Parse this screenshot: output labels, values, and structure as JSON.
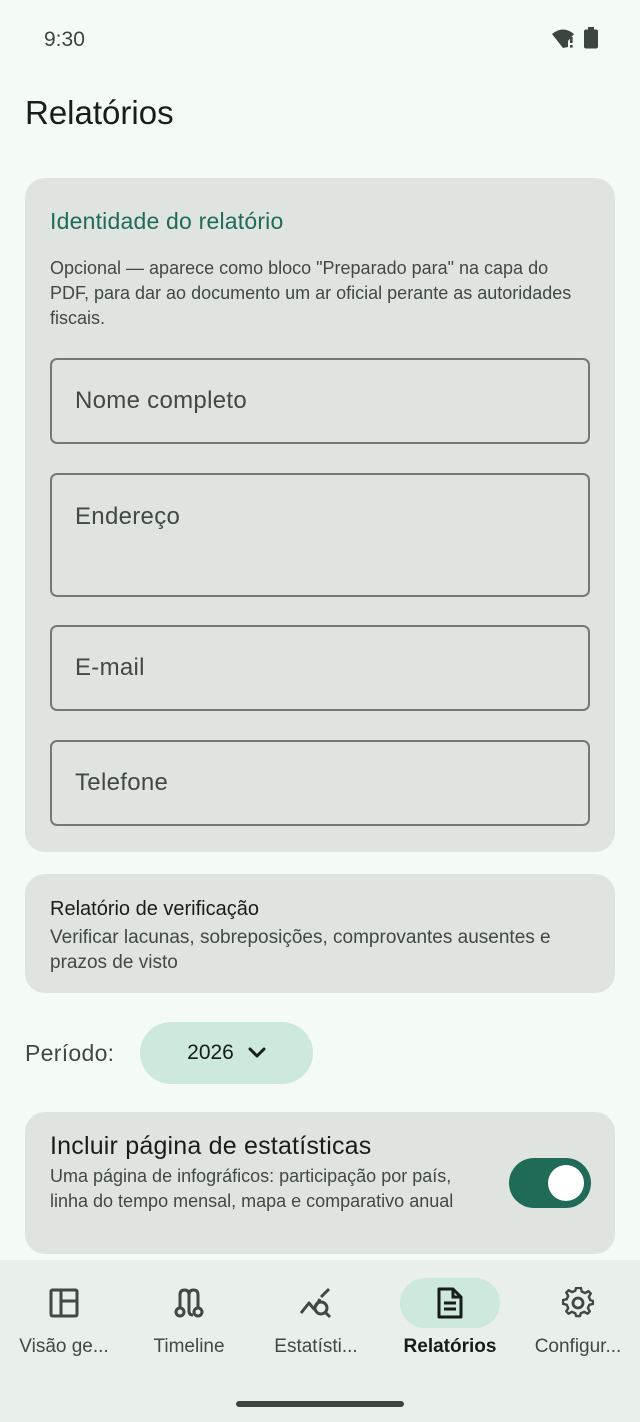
{
  "status_bar": {
    "time": "9:30",
    "icons": [
      "wifi-alert-icon",
      "battery-icon"
    ]
  },
  "page": {
    "title": "Relatórios"
  },
  "identity": {
    "heading": "Identidade do relatório",
    "description": "Opcional — aparece como bloco \"Preparado para\" na capa do PDF, para dar ao documento um ar oficial perante as autoridades fiscais.",
    "fields": {
      "name_placeholder": "Nome completo",
      "address_placeholder": "Endereço",
      "email_placeholder": "E-mail",
      "phone_placeholder": "Telefone"
    }
  },
  "verification": {
    "title": "Relatório de verificação",
    "subtitle": "Verificar lacunas, sobreposições, comprovantes ausentes e prazos de visto"
  },
  "period": {
    "label": "Período:",
    "value": "2026"
  },
  "stats_option": {
    "title": "Incluir página de estatísticas",
    "description": "Uma página de infográficos: participação por país, linha do tempo mensal, mapa e comparativo anual",
    "enabled": true
  },
  "nav": {
    "items": [
      {
        "label": "Visão ge...",
        "icon": "dashboard-icon"
      },
      {
        "label": "Timeline",
        "icon": "timeline-route-icon"
      },
      {
        "label": "Estatísti...",
        "icon": "stats-search-icon"
      },
      {
        "label": "Relatórios",
        "icon": "document-icon"
      },
      {
        "label": "Configur...",
        "icon": "gear-icon"
      }
    ],
    "active_index": 3
  },
  "colors": {
    "accent": "#1f6b58",
    "chip": "#cde8dc",
    "card": "#dfe4e0",
    "background": "#f4faf6"
  }
}
